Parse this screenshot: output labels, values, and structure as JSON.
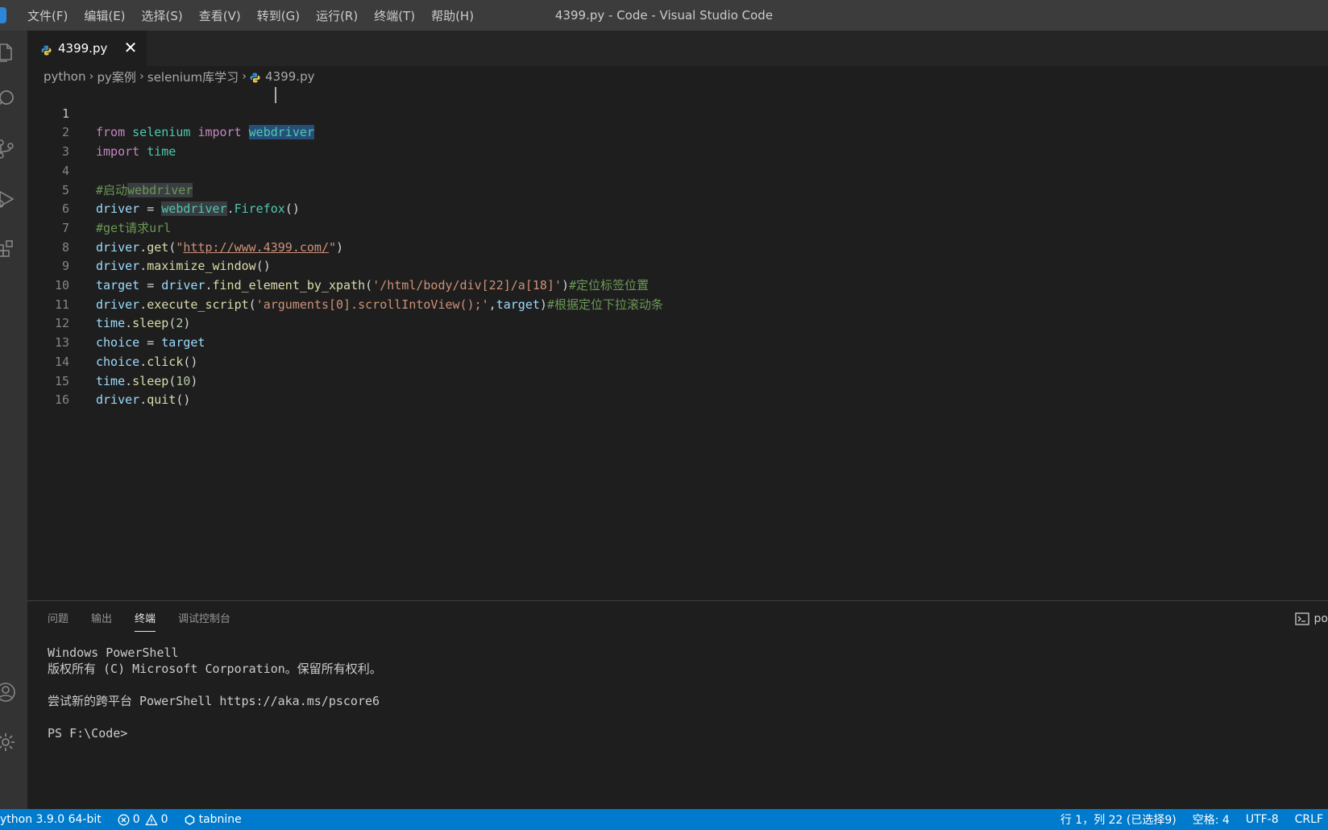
{
  "window": {
    "title": "4399.py - Code - Visual Studio Code"
  },
  "menu": [
    "文件(F)",
    "编辑(E)",
    "选择(S)",
    "查看(V)",
    "转到(G)",
    "运行(R)",
    "终端(T)",
    "帮助(H)"
  ],
  "tab": {
    "label": "4399.py",
    "close": "✕"
  },
  "breadcrumb": [
    "python",
    "py案例",
    "selenium库学习",
    "4399.py"
  ],
  "code": {
    "line_numbers": [
      "1",
      "2",
      "3",
      "4",
      "5",
      "6",
      "7",
      "8",
      "9",
      "10",
      "11",
      "12",
      "13",
      "14",
      "15",
      "16"
    ],
    "l1": {
      "kw1": "from",
      "mod": "selenium",
      "kw2": "import",
      "sel": "webdriver"
    },
    "l2": {
      "kw": "import",
      "mod": "time"
    },
    "l4": {
      "hash": "#启动",
      "hl": "webdriver"
    },
    "l5": {
      "var": "driver",
      "eq": " = ",
      "hl": "webdriver",
      "dot": ".",
      "cls": "Firefox",
      "paren": "()"
    },
    "l6": {
      "cmt": "#get请求url"
    },
    "l7": {
      "var": "driver",
      "dot": ".",
      "fn": "get",
      "open": "(",
      "q1": "\"",
      "url": "http://www.4399.com/",
      "q2": "\"",
      "close": ")"
    },
    "l8": {
      "var": "driver",
      "dot": ".",
      "fn": "maximize_window",
      "paren": "()"
    },
    "l9": {
      "var1": "target",
      "eq": " = ",
      "var2": "driver",
      "dot": ".",
      "fn": "find_element_by_xpath",
      "open": "(",
      "str": "'/html/body/div[22]/a[18]'",
      "close": ")",
      "cmt": "#定位标签位置"
    },
    "l10": {
      "var": "driver",
      "dot": ".",
      "fn": "execute_script",
      "open": "(",
      "str": "'arguments[0].scrollIntoView();'",
      "comma": ",",
      "var2": "target",
      "close": ")",
      "cmt": "#根据定位下拉滚动条"
    },
    "l11": {
      "var": "time",
      "dot": ".",
      "fn": "sleep",
      "open": "(",
      "num": "2",
      "close": ")"
    },
    "l12": {
      "var1": "choice",
      "eq": " = ",
      "var2": "target"
    },
    "l13": {
      "var": "choice",
      "dot": ".",
      "fn": "click",
      "paren": "()"
    },
    "l14": {
      "var": "time",
      "dot": ".",
      "fn": "sleep",
      "open": "(",
      "num": "10",
      "close": ")"
    },
    "l15": {
      "var": "driver",
      "dot": ".",
      "fn": "quit",
      "paren": "()"
    }
  },
  "panel": {
    "tabs": [
      "问题",
      "输出",
      "终端",
      "调试控制台"
    ],
    "right_label": "po"
  },
  "terminal": [
    "Windows PowerShell",
    "版权所有 (C) Microsoft Corporation。保留所有权利。",
    "",
    "尝试新的跨平台 PowerShell https://aka.ms/pscore6",
    "",
    "PS F:\\Code>"
  ],
  "statusbar": {
    "interpreter": "ython 3.9.0 64-bit",
    "errors": "0",
    "warnings": "0",
    "tabnine": "tabnine",
    "position": "行 1，列 22 (已选择9)",
    "spaces": "空格: 4",
    "encoding": "UTF-8",
    "eol": "CRLF"
  },
  "colors": {
    "statusbar": "#007acc",
    "titlebar": "#3c3c3c",
    "editor_bg": "#1e1e1e",
    "keyword": "#c586c0",
    "module": "#4ec9b0",
    "variable": "#9cdcfe",
    "function": "#dcdcaa",
    "string": "#ce9178",
    "comment": "#6a9955"
  }
}
